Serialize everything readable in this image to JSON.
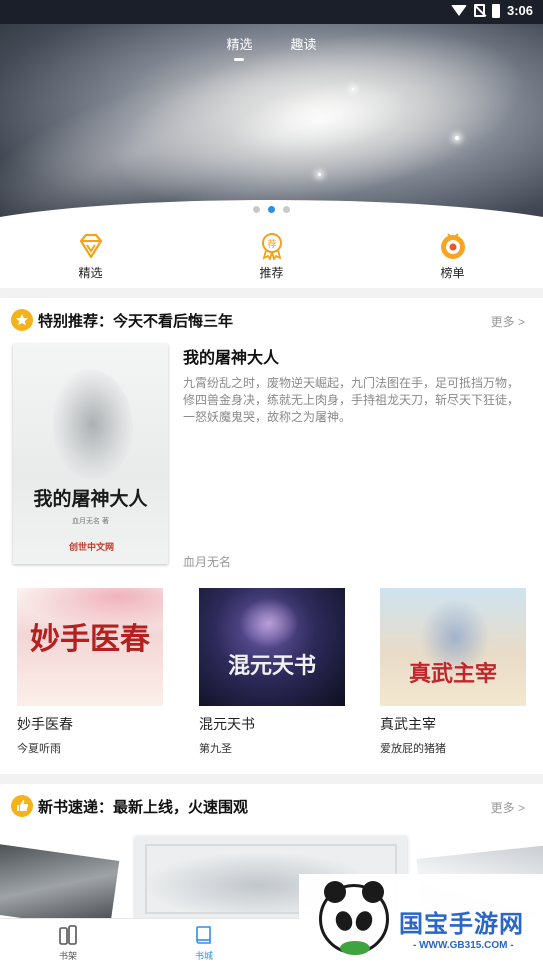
{
  "status_bar": {
    "time": "3:06",
    "icons": [
      "wifi-icon",
      "no-sim-icon",
      "battery-icon"
    ]
  },
  "top_tabs": [
    {
      "label": "精选",
      "active": true
    },
    {
      "label": "趣读",
      "active": false
    }
  ],
  "banner": {
    "slides": 3,
    "active_index": 1,
    "indicator_color": "#2e8ee6"
  },
  "categories": [
    {
      "label": "精选",
      "icon": "diamond-icon"
    },
    {
      "label": "推荐",
      "icon": "recommend-medal-icon"
    },
    {
      "label": "榜单",
      "icon": "ranking-medal-icon"
    }
  ],
  "section_special": {
    "title": "特别推荐：今天不看后悔三年",
    "more": "更多 >",
    "icon": "star-badge-icon",
    "featured": {
      "title": "我的屠神大人",
      "description": "九霄纷乱之时，废物逆天崛起，九门法图在手，足可抵挡万物，修四兽金身决，练就无上肉身，手持祖龙天刀，斩尽天下狂徒，一怒妖魔鬼哭，故称之为屠神。",
      "author": "血月无名",
      "cover": {
        "title": "我的屠神大人",
        "author_line": "血月无名 著",
        "publisher": "创世中文网"
      }
    },
    "books": [
      {
        "title": "妙手医春",
        "author": "今夏听雨",
        "cover_text": "妙手医春"
      },
      {
        "title": "混元天书",
        "author": "第九圣",
        "cover_text": "混元天书"
      },
      {
        "title": "真武主宰",
        "author": "爱放屁的猪猪",
        "cover_text": "真武主宰"
      }
    ]
  },
  "section_new": {
    "title": "新书速递：最新上线，火速围观",
    "more": "更多 >",
    "icon": "thumbs-up-badge-icon"
  },
  "watermark": {
    "title": "国宝手游网",
    "url": "- WWW.GB315.COM -"
  },
  "bottom_nav": [
    {
      "label": "书架",
      "icon": "bookshelf-icon",
      "active": false
    },
    {
      "label": "书城",
      "icon": "book-store-icon",
      "active": true
    }
  ],
  "colors": {
    "accent": "#2e8ee6",
    "badge": "#f6b21a",
    "watermark_blue": "#2a66c8"
  }
}
